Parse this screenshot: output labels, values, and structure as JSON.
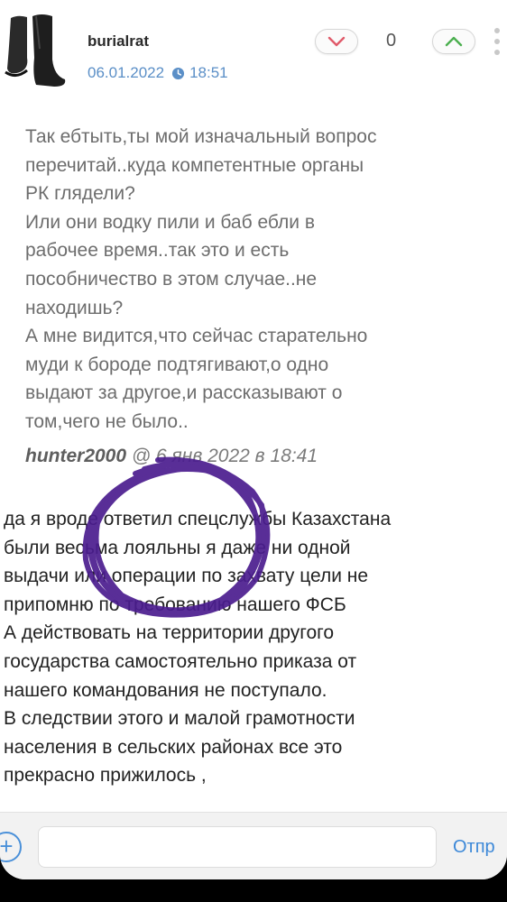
{
  "post": {
    "username": "burialrat",
    "date": "06.01.2022",
    "time": "18:51",
    "vote_count": "0"
  },
  "quote": {
    "text": "Так ебтыть,ты мой изначальный вопрос\nперечитай..куда компетентные органы\nРК глядели?\nИли они водку пили и баб ебли в\nрабочее время..так это и есть\nпособничество в этом случае..не\nнаходишь?\nА мне видится,что сейчас старательно\nмуди к бороде подтягивают,о одно\nвыдают за другое,и рассказывают о\nтом,чего не было..",
    "author": "hunter2000",
    "timestamp": "@ 6 янв 2022 в 18:41"
  },
  "reply": {
    "text": "да я вроде ответил спецслужбы Казахстана\nбыли весьма лояльны я даже ни одной\nвыдачи или операции по захвату цели не\nприпомню по требованию нашего ФСБ\nА действовать на территории другого\nгосударства самостоятельно приказа от\nнашего командования не поступало.\nВ следствии этого и малой грамотности\nнаселения в сельских районах все это\nпрекрасно прижилось ,"
  },
  "composer": {
    "add_label": "+",
    "input_value": "",
    "send_label": "Отпр"
  },
  "icons": {
    "avatar": "boots-avatar",
    "clock": "clock-icon",
    "down": "chevron-down-icon",
    "up": "chevron-up-icon",
    "menu": "vertical-dots-icon"
  },
  "colors": {
    "accent": "#3c88d8",
    "downvote": "#e05a6a",
    "upvote": "#4caf50",
    "scribble": "#4b1d8f"
  }
}
